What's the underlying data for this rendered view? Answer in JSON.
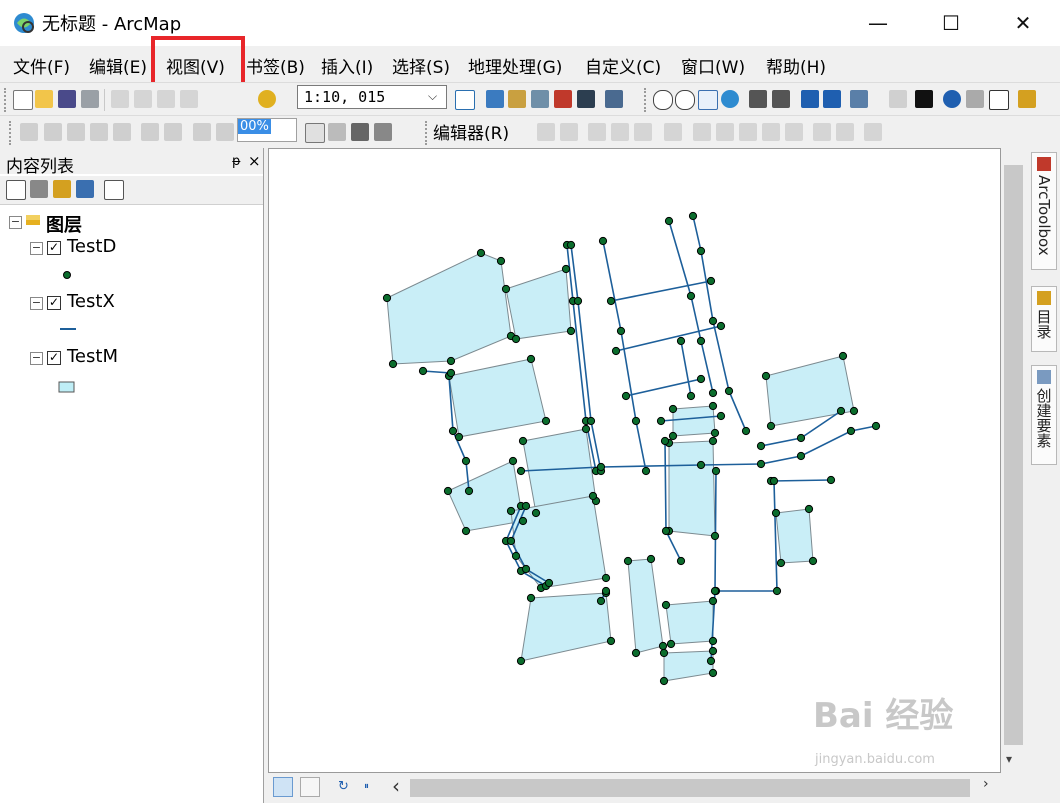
{
  "window": {
    "title": "无标题 - ArcMap",
    "controls": {
      "minimize": "—",
      "maximize": "☐",
      "close": "✕"
    }
  },
  "menu": {
    "items": [
      "文件(F)",
      "编辑(E)",
      "视图(V)",
      "书签(B)",
      "插入(I)",
      "选择(S)",
      "地理处理(G)",
      "自定义(C)",
      "窗口(W)",
      "帮助(H)"
    ],
    "highlighted": "视图(V)",
    "highlight_color": "#e8262a"
  },
  "toolbar": {
    "scale_value": "1:10, 015",
    "zoom_percent": "00%",
    "editor_label": "编辑器(R)"
  },
  "toc": {
    "title": "内容列表",
    "pin": "ᵽ",
    "close": "×",
    "root_label": "图层",
    "layers": [
      {
        "name": "TestD",
        "checked": true,
        "symbol": "point",
        "color": "#0b6d2d"
      },
      {
        "name": "TestX",
        "checked": true,
        "symbol": "line",
        "color": "#1d5f9a"
      },
      {
        "name": "TestM",
        "checked": true,
        "symbol": "polygon",
        "color": "#bfeef6"
      }
    ]
  },
  "map": {
    "polygon_fill": "#c9eef7",
    "polygon_stroke": "#7c8a90",
    "line_color": "#1d5f9a",
    "point_fill": "#0b6d2d"
  },
  "dock": {
    "tabs": [
      "ArcToolbox",
      "目录",
      "创建要素"
    ]
  },
  "statusbar": {
    "refresh_icon": "↻",
    "pause_icon": "⏸",
    "left_arrow": "‹"
  },
  "watermark": {
    "text": "Bai 经验",
    "sub": "jingyan.baidu.com"
  }
}
